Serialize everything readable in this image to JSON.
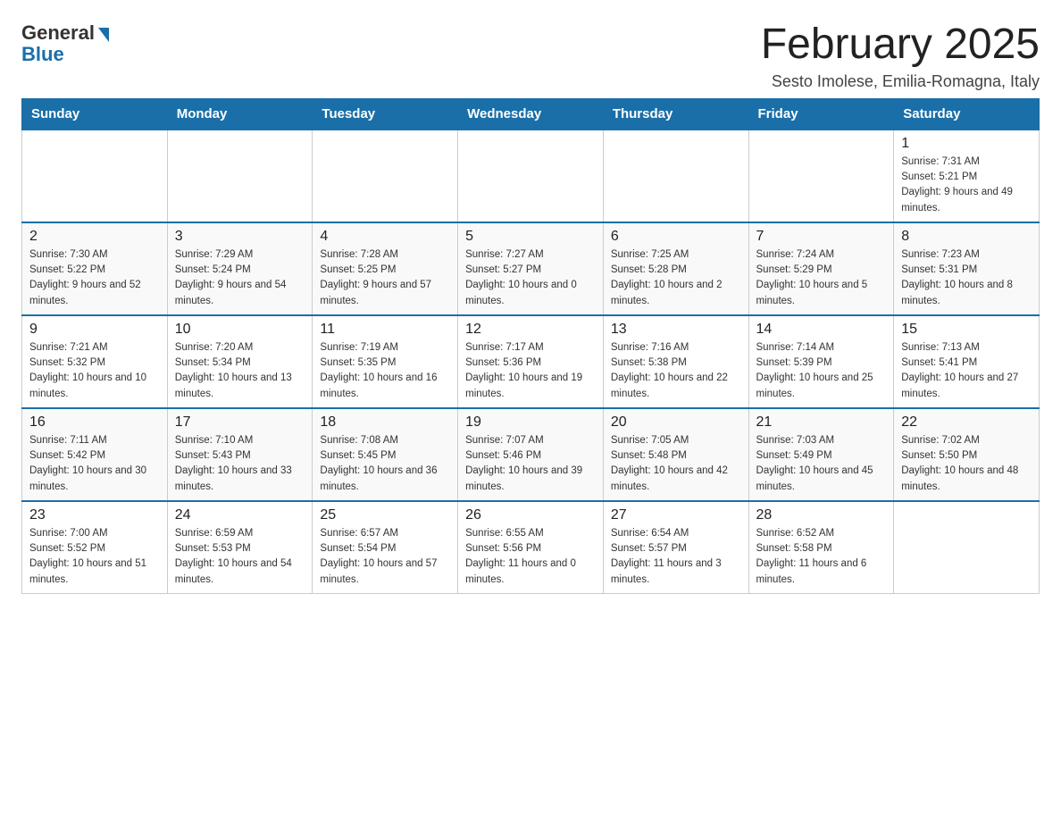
{
  "header": {
    "logo": {
      "general": "General",
      "blue": "Blue"
    },
    "title": "February 2025",
    "location": "Sesto Imolese, Emilia-Romagna, Italy"
  },
  "weekdays": [
    "Sunday",
    "Monday",
    "Tuesday",
    "Wednesday",
    "Thursday",
    "Friday",
    "Saturday"
  ],
  "weeks": [
    [
      {
        "day": "",
        "info": ""
      },
      {
        "day": "",
        "info": ""
      },
      {
        "day": "",
        "info": ""
      },
      {
        "day": "",
        "info": ""
      },
      {
        "day": "",
        "info": ""
      },
      {
        "day": "",
        "info": ""
      },
      {
        "day": "1",
        "info": "Sunrise: 7:31 AM\nSunset: 5:21 PM\nDaylight: 9 hours and 49 minutes."
      }
    ],
    [
      {
        "day": "2",
        "info": "Sunrise: 7:30 AM\nSunset: 5:22 PM\nDaylight: 9 hours and 52 minutes."
      },
      {
        "day": "3",
        "info": "Sunrise: 7:29 AM\nSunset: 5:24 PM\nDaylight: 9 hours and 54 minutes."
      },
      {
        "day": "4",
        "info": "Sunrise: 7:28 AM\nSunset: 5:25 PM\nDaylight: 9 hours and 57 minutes."
      },
      {
        "day": "5",
        "info": "Sunrise: 7:27 AM\nSunset: 5:27 PM\nDaylight: 10 hours and 0 minutes."
      },
      {
        "day": "6",
        "info": "Sunrise: 7:25 AM\nSunset: 5:28 PM\nDaylight: 10 hours and 2 minutes."
      },
      {
        "day": "7",
        "info": "Sunrise: 7:24 AM\nSunset: 5:29 PM\nDaylight: 10 hours and 5 minutes."
      },
      {
        "day": "8",
        "info": "Sunrise: 7:23 AM\nSunset: 5:31 PM\nDaylight: 10 hours and 8 minutes."
      }
    ],
    [
      {
        "day": "9",
        "info": "Sunrise: 7:21 AM\nSunset: 5:32 PM\nDaylight: 10 hours and 10 minutes."
      },
      {
        "day": "10",
        "info": "Sunrise: 7:20 AM\nSunset: 5:34 PM\nDaylight: 10 hours and 13 minutes."
      },
      {
        "day": "11",
        "info": "Sunrise: 7:19 AM\nSunset: 5:35 PM\nDaylight: 10 hours and 16 minutes."
      },
      {
        "day": "12",
        "info": "Sunrise: 7:17 AM\nSunset: 5:36 PM\nDaylight: 10 hours and 19 minutes."
      },
      {
        "day": "13",
        "info": "Sunrise: 7:16 AM\nSunset: 5:38 PM\nDaylight: 10 hours and 22 minutes."
      },
      {
        "day": "14",
        "info": "Sunrise: 7:14 AM\nSunset: 5:39 PM\nDaylight: 10 hours and 25 minutes."
      },
      {
        "day": "15",
        "info": "Sunrise: 7:13 AM\nSunset: 5:41 PM\nDaylight: 10 hours and 27 minutes."
      }
    ],
    [
      {
        "day": "16",
        "info": "Sunrise: 7:11 AM\nSunset: 5:42 PM\nDaylight: 10 hours and 30 minutes."
      },
      {
        "day": "17",
        "info": "Sunrise: 7:10 AM\nSunset: 5:43 PM\nDaylight: 10 hours and 33 minutes."
      },
      {
        "day": "18",
        "info": "Sunrise: 7:08 AM\nSunset: 5:45 PM\nDaylight: 10 hours and 36 minutes."
      },
      {
        "day": "19",
        "info": "Sunrise: 7:07 AM\nSunset: 5:46 PM\nDaylight: 10 hours and 39 minutes."
      },
      {
        "day": "20",
        "info": "Sunrise: 7:05 AM\nSunset: 5:48 PM\nDaylight: 10 hours and 42 minutes."
      },
      {
        "day": "21",
        "info": "Sunrise: 7:03 AM\nSunset: 5:49 PM\nDaylight: 10 hours and 45 minutes."
      },
      {
        "day": "22",
        "info": "Sunrise: 7:02 AM\nSunset: 5:50 PM\nDaylight: 10 hours and 48 minutes."
      }
    ],
    [
      {
        "day": "23",
        "info": "Sunrise: 7:00 AM\nSunset: 5:52 PM\nDaylight: 10 hours and 51 minutes."
      },
      {
        "day": "24",
        "info": "Sunrise: 6:59 AM\nSunset: 5:53 PM\nDaylight: 10 hours and 54 minutes."
      },
      {
        "day": "25",
        "info": "Sunrise: 6:57 AM\nSunset: 5:54 PM\nDaylight: 10 hours and 57 minutes."
      },
      {
        "day": "26",
        "info": "Sunrise: 6:55 AM\nSunset: 5:56 PM\nDaylight: 11 hours and 0 minutes."
      },
      {
        "day": "27",
        "info": "Sunrise: 6:54 AM\nSunset: 5:57 PM\nDaylight: 11 hours and 3 minutes."
      },
      {
        "day": "28",
        "info": "Sunrise: 6:52 AM\nSunset: 5:58 PM\nDaylight: 11 hours and 6 minutes."
      },
      {
        "day": "",
        "info": ""
      }
    ]
  ]
}
